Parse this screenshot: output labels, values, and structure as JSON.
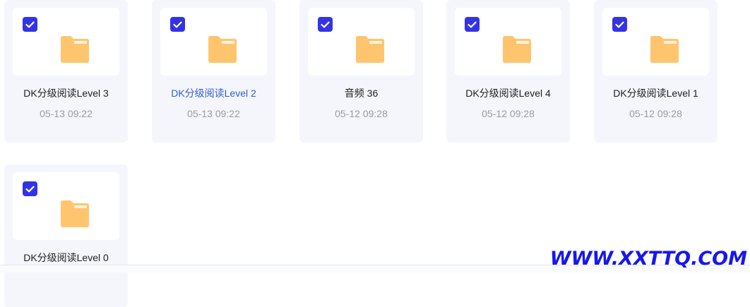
{
  "files": [
    {
      "name": "DK分级阅读Level 3",
      "date": "05-13 09:22",
      "checked": true,
      "active": false
    },
    {
      "name": "DK分级阅读Level 2",
      "date": "05-13 09:22",
      "checked": true,
      "active": true
    },
    {
      "name": "音频 36",
      "date": "05-12 09:28",
      "checked": true,
      "active": false
    },
    {
      "name": "DK分级阅读Level 4",
      "date": "05-12 09:28",
      "checked": true,
      "active": false
    },
    {
      "name": "DK分级阅读Level 1",
      "date": "05-12 09:28",
      "checked": true,
      "active": false
    },
    {
      "name": "DK分级阅读Level 0",
      "date": "",
      "checked": true,
      "active": false
    }
  ],
  "icons": {
    "checkbox": "checkmark-icon",
    "folder": "folder-icon"
  },
  "colors": {
    "accent": "#3333e6",
    "folder": "#ffc56e",
    "folder_tab": "#ffd98f",
    "active_text": "#2f5fc9",
    "watermark": "#1717ef"
  },
  "watermark": {
    "text": "WWW.XXTTQ.COM"
  }
}
